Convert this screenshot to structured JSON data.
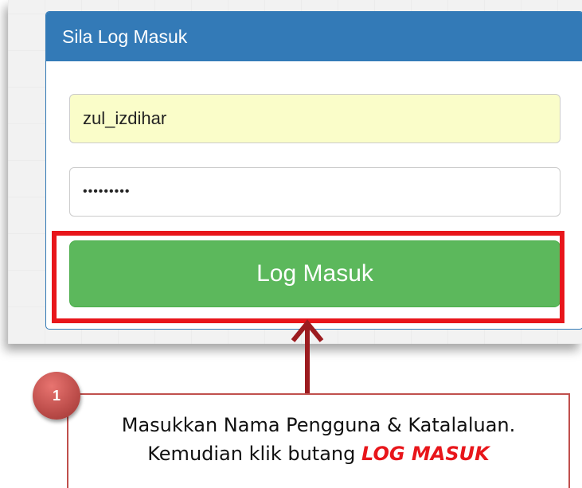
{
  "login_panel": {
    "title": "Sila Log Masuk",
    "username_value": "zul_izdihar",
    "password_value": "•••••••••",
    "submit_label": "Log Masuk"
  },
  "annotation": {
    "step_number": "1",
    "instruction_line1": "Masukkan Nama Pengguna  & Katalaluan.",
    "instruction_line2_prefix": "Kemudian klik butang ",
    "instruction_line2_emphasis": "LOG MASUK"
  },
  "colors": {
    "panel_header": "#337ab7",
    "username_bg": "#fafdc9",
    "login_button": "#5cb85c",
    "highlight": "#e8161b",
    "badge": "#c0504d"
  }
}
